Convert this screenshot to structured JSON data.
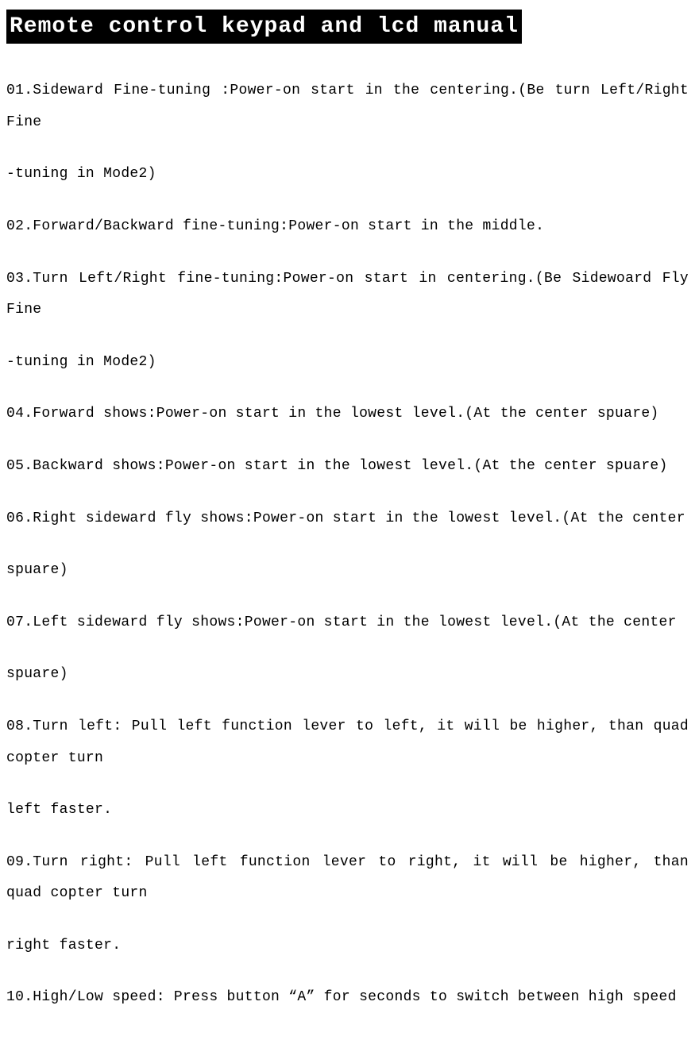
{
  "title": "Remote control keypad and lcd manual",
  "paragraphs": [
    "01.Sideward Fine-tuning :Power-on start in the centering.(Be turn Left/Right Fine",
    "-tuning in Mode2)",
    "02.Forward/Backward fine-tuning:Power-on start in the middle.",
    "03.Turn Left/Right fine-tuning:Power-on start in centering.(Be Sidewoard Fly Fine",
    "-tuning in Mode2)",
    "04.Forward shows:Power-on start in the lowest level.(At the center spuare)",
    "05.Backward shows:Power-on start in the lowest level.(At the center spuare)",
    "06.Right sideward fly shows:Power-on start in the lowest level.(At the center",
    "",
    "spuare)",
    "07.Left sideward fly shows:Power-on start in the lowest level.(At the center",
    "spuare)",
    "08.Turn left: Pull left function lever to left, it will be higher, than quad copter turn",
    "left faster.",
    "09.Turn right: Pull left function lever to right, it will be higher, than quad copter turn",
    "right faster.",
    "10.High/Low speed: Press button “A” for seconds to switch between high speed"
  ]
}
